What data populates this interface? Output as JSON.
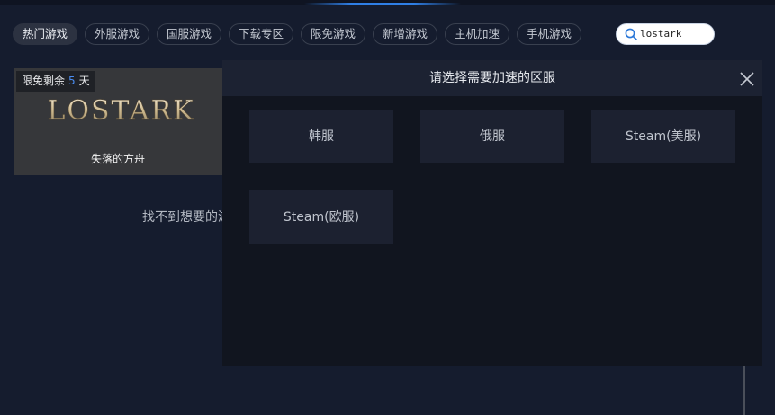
{
  "tabs": [
    {
      "label": "热门游戏",
      "active": true
    },
    {
      "label": "外服游戏",
      "active": false
    },
    {
      "label": "国服游戏",
      "active": false
    },
    {
      "label": "下载专区",
      "active": false
    },
    {
      "label": "限免游戏",
      "active": false
    },
    {
      "label": "新增游戏",
      "active": false
    },
    {
      "label": "主机加速",
      "active": false
    },
    {
      "label": "手机游戏",
      "active": false
    }
  ],
  "search": {
    "value": "lostark",
    "icon": "search-icon"
  },
  "game_card": {
    "badge_prefix": "限免剩余",
    "badge_days": "5",
    "badge_suffix": "天",
    "logo_text": "LOSTARK",
    "name": "失落的方舟"
  },
  "hint_text": "找不到想要的游戏？",
  "modal": {
    "title": "请选择需要加速的区服",
    "close_icon": "close-icon",
    "regions": [
      "韩服",
      "俄服",
      "Steam(美服)",
      "Steam(欧服)"
    ]
  },
  "colors": {
    "background": "#151c2e",
    "modal": "#11151f",
    "modal_header": "#1c2232",
    "region_button": "#1c2130",
    "accent": "#4a8cf0"
  }
}
